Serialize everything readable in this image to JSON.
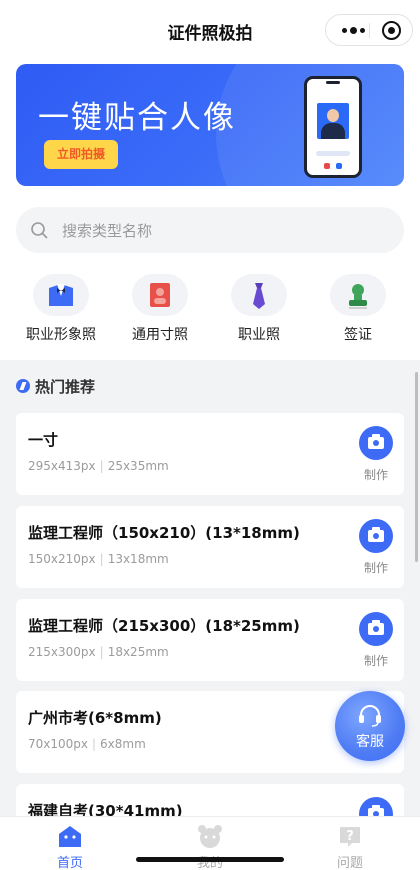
{
  "app": {
    "title": "证件照极拍"
  },
  "banner": {
    "headline": "一键贴合人像",
    "button_label": "立即拍摄"
  },
  "search": {
    "placeholder": "搜索类型名称"
  },
  "categories": [
    {
      "label": "职业形象照",
      "icon": "suit-icon"
    },
    {
      "label": "通用寸照",
      "icon": "red-photo-icon"
    },
    {
      "label": "职业照",
      "icon": "tie-icon"
    },
    {
      "label": "签证",
      "icon": "visa-stamp-icon"
    }
  ],
  "section": {
    "title": "热门推荐",
    "icon": "lightning-icon"
  },
  "cards": [
    {
      "title": "一寸",
      "px": "295x413px",
      "mm": "25x35mm",
      "action": "制作"
    },
    {
      "title": "监理工程师（150x210）(13*18mm)",
      "px": "150x210px",
      "mm": "13x18mm",
      "action": "制作"
    },
    {
      "title": "监理工程师（215x300）(18*25mm)",
      "px": "215x300px",
      "mm": "18x25mm",
      "action": "制作"
    },
    {
      "title": "广州市考(6*8mm)",
      "px": "70x100px",
      "mm": "6x8mm",
      "action": "制作"
    },
    {
      "title": "福建自考(30*41mm)",
      "px": "",
      "mm": "",
      "action": ""
    }
  ],
  "service": {
    "label": "客服"
  },
  "tabbar": [
    {
      "label": "首页",
      "icon": "home-icon",
      "active": true
    },
    {
      "label": "我的",
      "icon": "bear-icon",
      "active": false
    },
    {
      "label": "问题",
      "icon": "question-icon",
      "active": false
    }
  ],
  "colors": {
    "accent": "#3e6bf5",
    "banner_button": "#ffd64a",
    "page_bg": "#f2f3f5"
  }
}
